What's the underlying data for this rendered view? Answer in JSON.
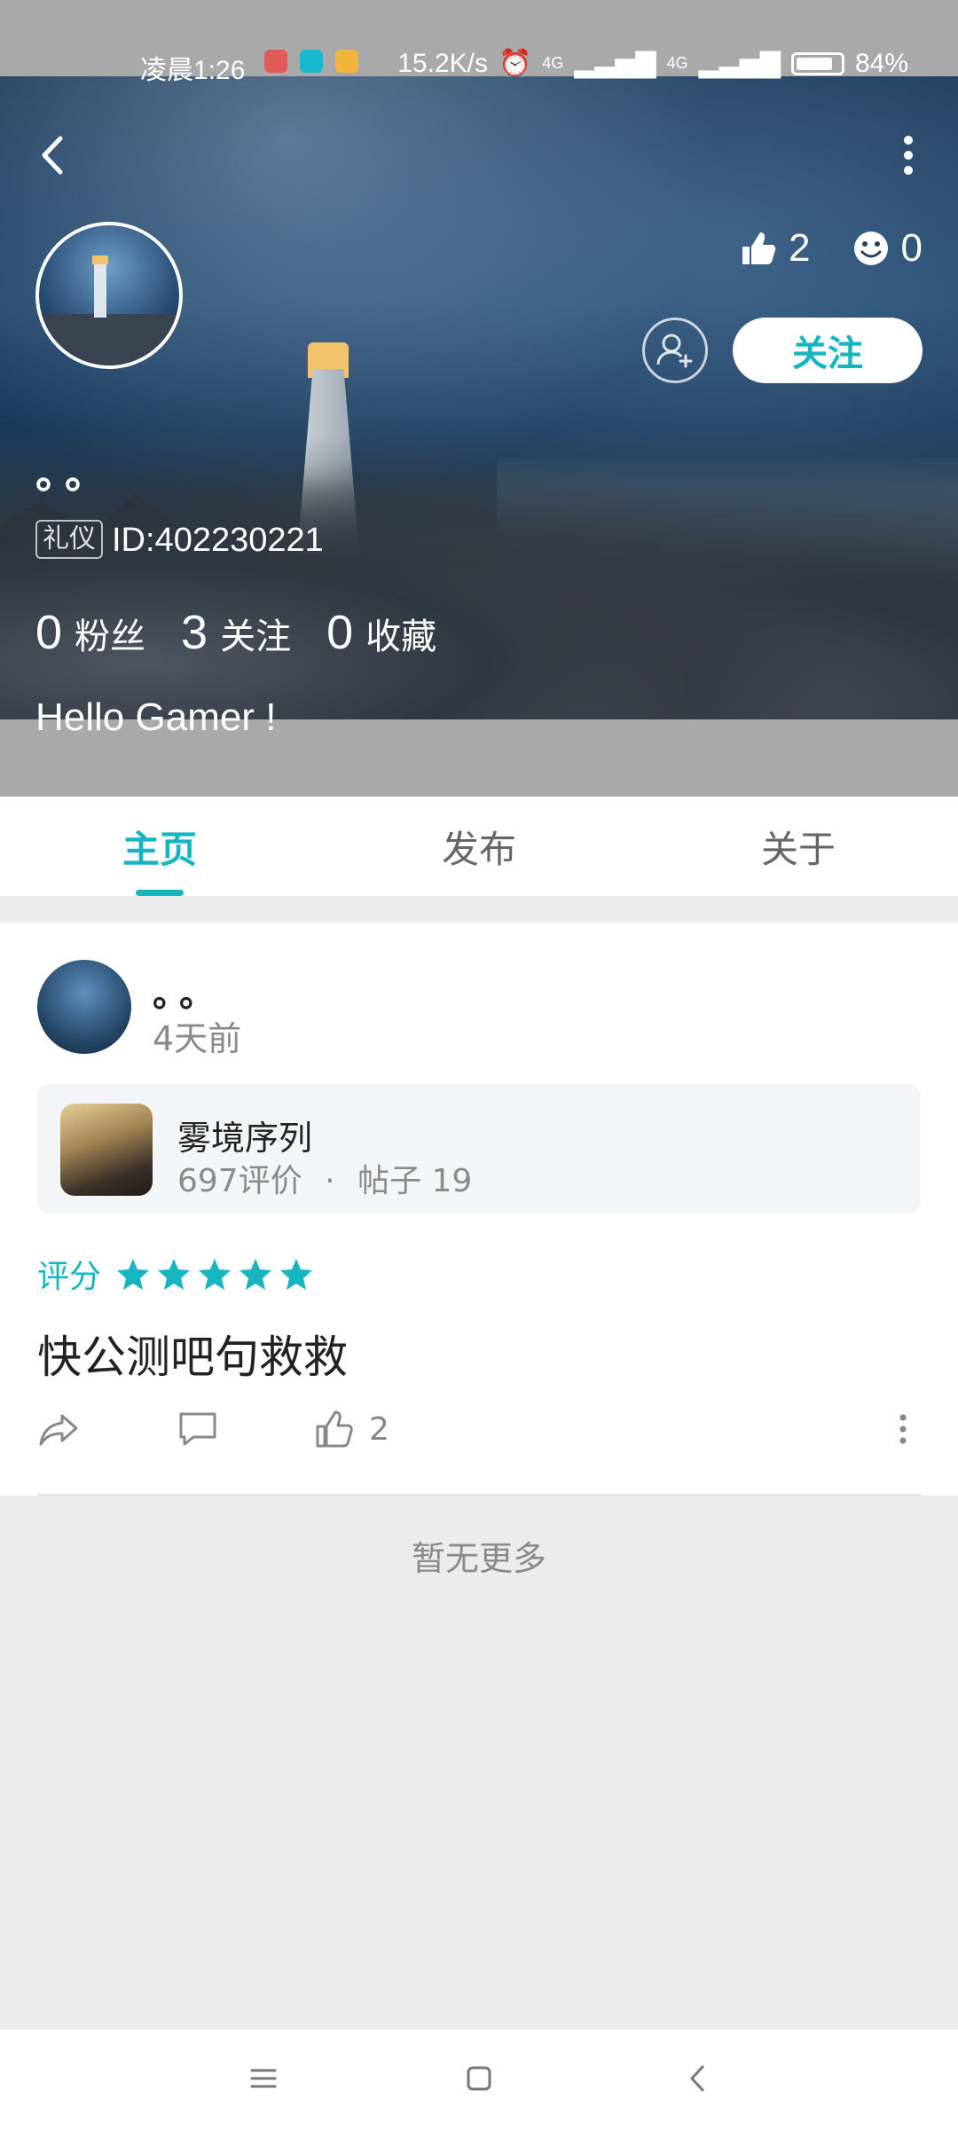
{
  "status_bar": {
    "time": "凌晨1:26",
    "net_speed": "15.2K/s",
    "signal_a": "4G",
    "signal_b": "4G",
    "battery": "84%",
    "app_icon_colors": [
      "#e05a5a",
      "#19b8d0",
      "#f0b53a"
    ]
  },
  "profile": {
    "nickname": "。。",
    "badge": "礼仪",
    "user_id": "ID:402230221",
    "likes": "2",
    "smiles": "0",
    "follow_button": "关注",
    "stats": [
      {
        "num": "0",
        "label": "粉丝"
      },
      {
        "num": "3",
        "label": "关注"
      },
      {
        "num": "0",
        "label": "收藏"
      }
    ],
    "bio": "Hello Gamer !"
  },
  "tabs": [
    {
      "label": "主页",
      "active": true
    },
    {
      "label": "发布",
      "active": false
    },
    {
      "label": "关于",
      "active": false
    }
  ],
  "post": {
    "author": "。。",
    "time": "4天前",
    "game": {
      "name": "雾境序列",
      "reviews": "697评价",
      "separator": "·",
      "posts": "帖子 19"
    },
    "rating_label": "评分",
    "stars": 5,
    "text": "快公测吧句救救",
    "like_count": "2"
  },
  "footer": {
    "no_more": "暂无更多"
  },
  "colors": {
    "accent": "#17b5c2",
    "background": "#ececec"
  }
}
